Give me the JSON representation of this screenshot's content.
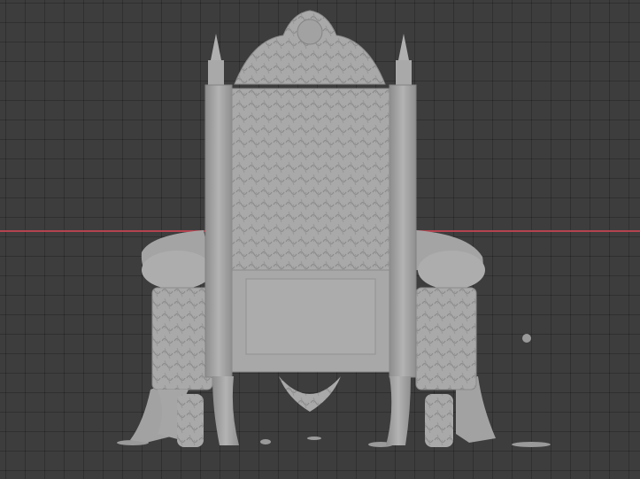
{
  "viewport": {
    "background_color": "#3d3d3d",
    "grid_line_color": "#2f2f2f",
    "x_axis_color": "#b3434f",
    "model_color": "#a7a7a7"
  },
  "scene": {
    "object": "throne-model",
    "view": "back"
  }
}
